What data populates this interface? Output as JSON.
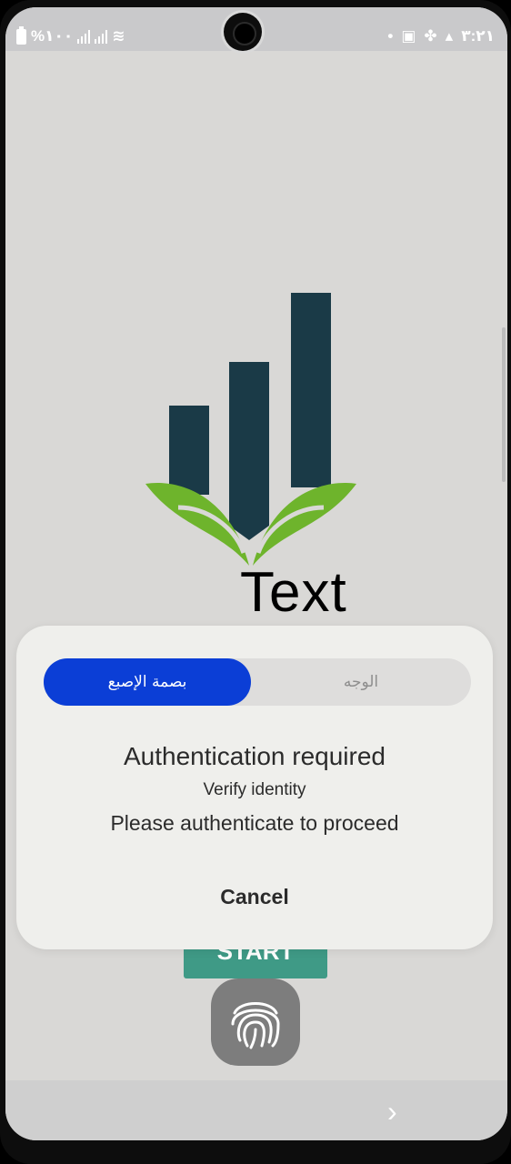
{
  "status_bar": {
    "battery_text": "%١٠٠",
    "time": "٣:٢١"
  },
  "logo": {
    "text": "Text",
    "colors": {
      "bars": "#1a3a47",
      "leaves": "#6eb42c"
    }
  },
  "background_button": {
    "label": "START"
  },
  "dialog": {
    "tabs": [
      {
        "label": "بصمة الإصبع",
        "active": true
      },
      {
        "label": "الوجه",
        "active": false
      }
    ],
    "title": "Authentication required",
    "subtitle": "Verify identity",
    "description": "Please authenticate to proceed",
    "cancel_label": "Cancel"
  },
  "colors": {
    "accent_blue": "#0b3ed6",
    "start_green": "#3f9a86"
  },
  "icons": [
    "battery-icon",
    "signal-icon",
    "wifi-icon",
    "notification-dot-icon",
    "app-icon",
    "fan-icon",
    "mail-icon",
    "fingerprint-icon",
    "chevron-right-icon"
  ]
}
